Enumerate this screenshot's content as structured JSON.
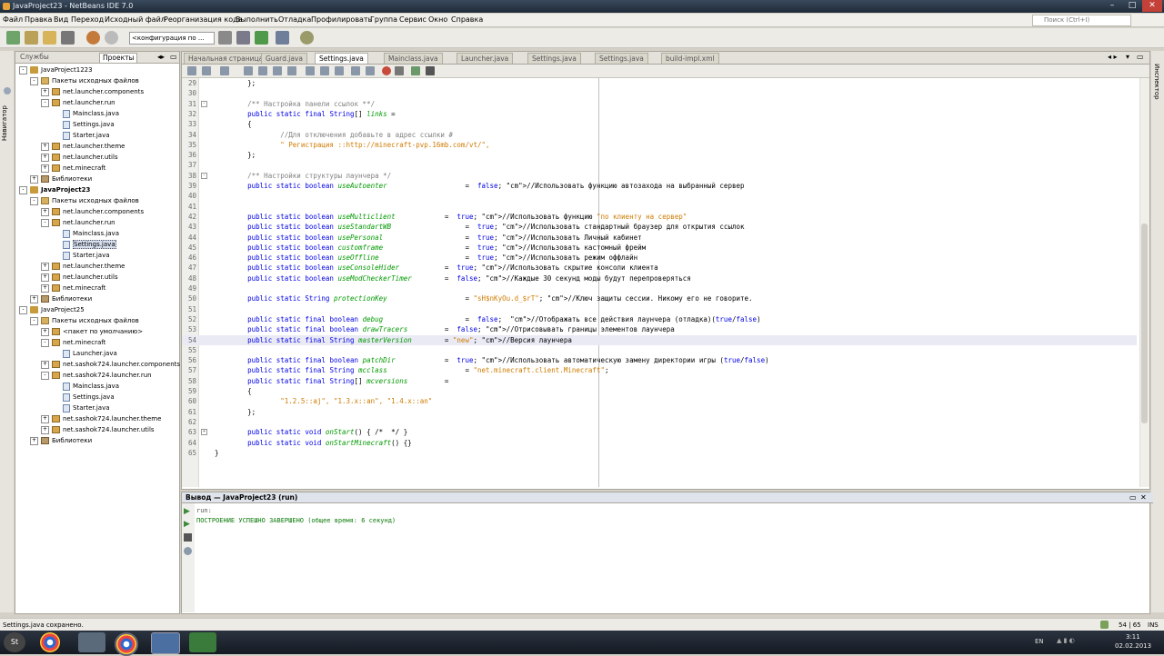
{
  "window": {
    "title": "JavaProject23 - NetBeans IDE 7.0"
  },
  "menu": [
    "Файл",
    "Правка",
    "Вид",
    "Переход",
    "Исходный файл",
    "Реорганизация кода",
    "Выполнить",
    "Отладка",
    "Профилировать",
    "Группа",
    "Сервис",
    "Окно",
    "Справка"
  ],
  "search": {
    "placeholder": "Поиск (Ctrl+I)"
  },
  "toolbar": {
    "config": "<конфигурация по ..."
  },
  "left_tabs": {
    "services": "Службы",
    "projects": "Проекты"
  },
  "left_strip_label": "Навигатор",
  "right_strip_label": "Инспектор",
  "tree": [
    {
      "label": "JavaProject1223",
      "level": 0,
      "type": "proj",
      "toggle": "-"
    },
    {
      "label": "Пакеты исходных файлов",
      "level": 1,
      "type": "src",
      "toggle": "-"
    },
    {
      "label": "net.launcher.components",
      "level": 2,
      "type": "pkg",
      "toggle": "+"
    },
    {
      "label": "net.launcher.run",
      "level": 2,
      "type": "pkg",
      "toggle": "-"
    },
    {
      "label": "Mainclass.java",
      "level": 3,
      "type": "java",
      "toggle": ""
    },
    {
      "label": "Settings.java",
      "level": 3,
      "type": "java",
      "toggle": ""
    },
    {
      "label": "Starter.java",
      "level": 3,
      "type": "java",
      "toggle": ""
    },
    {
      "label": "net.launcher.theme",
      "level": 2,
      "type": "pkg",
      "toggle": "+"
    },
    {
      "label": "net.launcher.utils",
      "level": 2,
      "type": "pkg",
      "toggle": "+"
    },
    {
      "label": "net.minecraft",
      "level": 2,
      "type": "pkg",
      "toggle": "+"
    },
    {
      "label": "Библиотеки",
      "level": 1,
      "type": "lib",
      "toggle": "+"
    },
    {
      "label": "JavaProject23",
      "level": 0,
      "type": "proj",
      "toggle": "-",
      "bold": true
    },
    {
      "label": "Пакеты исходных файлов",
      "level": 1,
      "type": "src",
      "toggle": "-"
    },
    {
      "label": "net.launcher.components",
      "level": 2,
      "type": "pkg",
      "toggle": "+"
    },
    {
      "label": "net.launcher.run",
      "level": 2,
      "type": "pkg",
      "toggle": "-"
    },
    {
      "label": "Mainclass.java",
      "level": 3,
      "type": "java",
      "toggle": ""
    },
    {
      "label": "Settings.java",
      "level": 3,
      "type": "java",
      "toggle": "",
      "selected": true
    },
    {
      "label": "Starter.java",
      "level": 3,
      "type": "java",
      "toggle": ""
    },
    {
      "label": "net.launcher.theme",
      "level": 2,
      "type": "pkg",
      "toggle": "+"
    },
    {
      "label": "net.launcher.utils",
      "level": 2,
      "type": "pkg",
      "toggle": "+"
    },
    {
      "label": "net.minecraft",
      "level": 2,
      "type": "pkg",
      "toggle": "+"
    },
    {
      "label": "Библиотеки",
      "level": 1,
      "type": "lib",
      "toggle": "+"
    },
    {
      "label": "JavaProject25",
      "level": 0,
      "type": "proj",
      "toggle": "-"
    },
    {
      "label": "Пакеты исходных файлов",
      "level": 1,
      "type": "src",
      "toggle": "-"
    },
    {
      "label": "<пакет по умолчанию>",
      "level": 2,
      "type": "pkg",
      "toggle": "+"
    },
    {
      "label": "net.minecraft",
      "level": 2,
      "type": "pkg",
      "toggle": "-"
    },
    {
      "label": "Launcher.java",
      "level": 3,
      "type": "java",
      "toggle": ""
    },
    {
      "label": "net.sashok724.launcher.components",
      "level": 2,
      "type": "pkg",
      "toggle": "+"
    },
    {
      "label": "net.sashok724.launcher.run",
      "level": 2,
      "type": "pkg",
      "toggle": "-"
    },
    {
      "label": "Mainclass.java",
      "level": 3,
      "type": "java",
      "toggle": ""
    },
    {
      "label": "Settings.java",
      "level": 3,
      "type": "java",
      "toggle": ""
    },
    {
      "label": "Starter.java",
      "level": 3,
      "type": "java",
      "toggle": ""
    },
    {
      "label": "net.sashok724.launcher.theme",
      "level": 2,
      "type": "pkg",
      "toggle": "+"
    },
    {
      "label": "net.sashok724.launcher.utils",
      "level": 2,
      "type": "pkg",
      "toggle": "+"
    },
    {
      "label": "Библиотеки",
      "level": 1,
      "type": "lib",
      "toggle": "+"
    }
  ],
  "editor_tabs": [
    {
      "label": "Начальная страница",
      "active": false
    },
    {
      "label": "Guard.java",
      "active": false
    },
    {
      "label": "Settings.java",
      "active": true
    },
    {
      "label": "Mainclass.java",
      "active": false
    },
    {
      "label": "Launcher.java",
      "active": false
    },
    {
      "label": "Settings.java",
      "active": false
    },
    {
      "label": "Settings.java",
      "active": false
    },
    {
      "label": "build-impl.xml",
      "active": false
    }
  ],
  "code_lines": [
    {
      "n": "29",
      "t": "        };"
    },
    {
      "n": "30",
      "t": ""
    },
    {
      "n": "31",
      "t": "        /** Настройка панели ссылок **/",
      "c": "cm",
      "fold": "-"
    },
    {
      "n": "32",
      "t": "        public static final String[] links =",
      "hl": "links"
    },
    {
      "n": "33",
      "t": "        {"
    },
    {
      "n": "34",
      "t": "                //Для отключения добавьте в адрес ссылки #",
      "c": "cm"
    },
    {
      "n": "35",
      "t": "                \" Регистрация ::http://minecraft-pvp.16mb.com/vt/\",",
      "c": "st"
    },
    {
      "n": "36",
      "t": "        };"
    },
    {
      "n": "37",
      "t": ""
    },
    {
      "n": "38",
      "t": "        /** Настройки структуры лаунчера */",
      "c": "cm",
      "fold": "-"
    },
    {
      "n": "39",
      "t": "        public static boolean useAutoenter                   =  false; //Использовать функцию автозахода на выбранный сервер",
      "hl": "useAutoenter"
    },
    {
      "n": "40",
      "t": ""
    },
    {
      "n": "41",
      "t": ""
    },
    {
      "n": "42",
      "t": "        public static boolean useMulticlient            =  true; //Использовать функцию \"по клиенту на сервер\"",
      "hl": "useMulticlient"
    },
    {
      "n": "43",
      "t": "        public static boolean useStandartWB                  =  true; //Использовать стандартный браузер для открытия ссылок",
      "hl": "useStandartWB"
    },
    {
      "n": "44",
      "t": "        public static boolean usePersonal                    =  true; //Использовать Личный кабинет",
      "hl": "usePersonal"
    },
    {
      "n": "45",
      "t": "        public static boolean customframe                    =  true; //Использовать кастомный фрейм",
      "hl": "customframe"
    },
    {
      "n": "46",
      "t": "        public static boolean useOffline                     =  true; //Использовать режим оффлайн",
      "hl": "useOffline"
    },
    {
      "n": "47",
      "t": "        public static boolean useConsoleHider           =  true; //Использовать скрытие консоли клиента",
      "hl": "useConsoleHider"
    },
    {
      "n": "48",
      "t": "        public static boolean useModCheckerTimer        =  false; //Каждые 30 секунд моды будут перепроверяться",
      "hl": "useModCheckerTimer"
    },
    {
      "n": "49",
      "t": ""
    },
    {
      "n": "50",
      "t": "        public static String protectionKey                   = \"sH$nKyOu.d_$rT\"; //Ключ защиты сессии. Никому его не говорите.",
      "hl": "protectionKey"
    },
    {
      "n": "51",
      "t": ""
    },
    {
      "n": "52",
      "t": "        public static final boolean debug                    =  false;  //Отображать все действия лаунчера (отладка)(true/false)",
      "hl": "debug"
    },
    {
      "n": "53",
      "t": "        public static final boolean drawTracers         =  false; //Отрисовывать границы элементов лаунчера",
      "hl": "drawTracers"
    },
    {
      "n": "54",
      "t": "        public static final String masterVersion        = \"new\"; //Версия лаунчера",
      "hl": "masterVersion",
      "current": true
    },
    {
      "n": "55",
      "t": ""
    },
    {
      "n": "56",
      "t": "        public static final boolean patchDir            =  true; //Использовать автоматическую замену директории игры (true/false)",
      "hl": "patchDir"
    },
    {
      "n": "57",
      "t": "        public static final String mcclass                   = \"net.minecraft.client.Minecraft\";",
      "hl": "mcclass"
    },
    {
      "n": "58",
      "t": "        public static final String[] mcversions         =",
      "hl": "mcversions"
    },
    {
      "n": "59",
      "t": "        {"
    },
    {
      "n": "60",
      "t": "                \"1.2.5::aj\", \"1.3.x::an\", \"1.4.x::an\"",
      "c": "st"
    },
    {
      "n": "61",
      "t": "        };"
    },
    {
      "n": "62",
      "t": ""
    },
    {
      "n": "63",
      "t": "        public static void onStart() { /*  */ }",
      "hl": "onStart",
      "fold": "+"
    },
    {
      "n": "64",
      "t": "        public static void onStartMinecraft() {}",
      "hl": "onStartMinecraft"
    },
    {
      "n": "65",
      "t": "}"
    }
  ],
  "output": {
    "title": "Вывод — JavaProject23 (run)",
    "lines": [
      "run:",
      "ПОСТРОЕНИЕ УСПЕШНО ЗАВЕРШЕНО (общее время: 6 секунд)"
    ]
  },
  "status": {
    "left": "Settings.java сохранено.",
    "pos": "54 | 65",
    "mode": "INS"
  },
  "taskbar": {
    "lang": "EN",
    "time": "3:11",
    "date": "02.02.2013"
  }
}
